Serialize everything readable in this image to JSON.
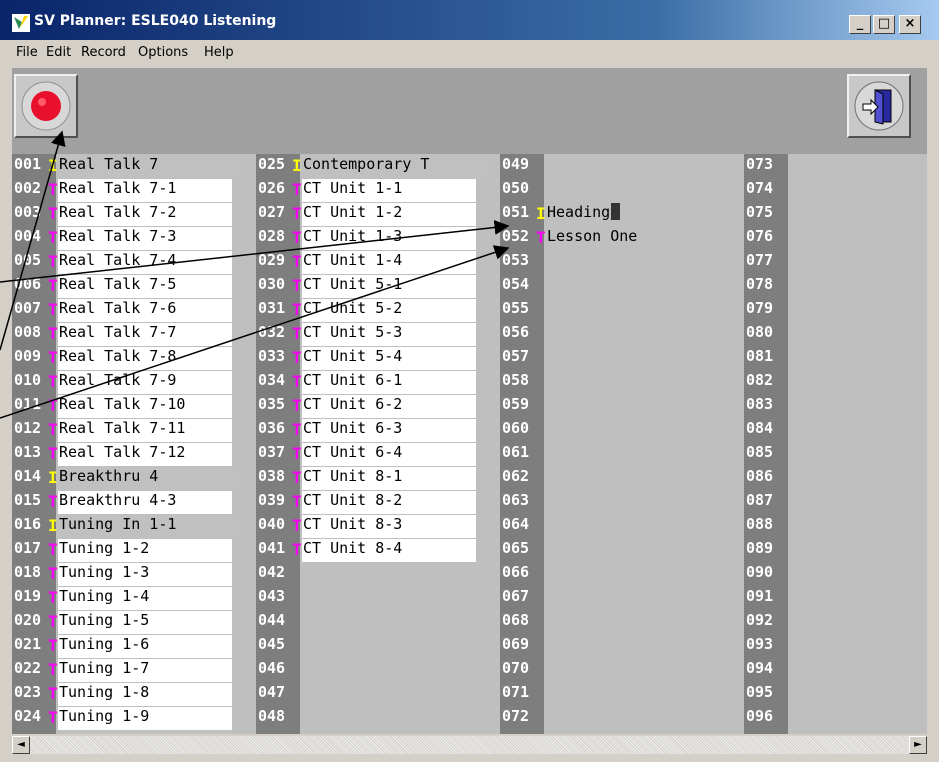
{
  "window": {
    "title": "SV Planner: ESLE040 Listening"
  },
  "caption_buttons": {
    "minimize": "_",
    "maximize": "□",
    "close": "×"
  },
  "menu": [
    "File",
    "Edit",
    "Record",
    "Options",
    "Help"
  ],
  "toolbar": {
    "record_icon": "record-icon",
    "exit_icon": "exit-door-icon"
  },
  "columns": [
    {
      "rows": [
        {
          "num": "001",
          "flag": "I",
          "text": "Real Talk 7",
          "bg": "grey"
        },
        {
          "num": "002",
          "flag": "T",
          "text": "Real Talk 7-1",
          "bg": "white"
        },
        {
          "num": "003",
          "flag": "T",
          "text": "Real Talk 7-2",
          "bg": "white"
        },
        {
          "num": "004",
          "flag": "T",
          "text": "Real Talk 7-3",
          "bg": "white"
        },
        {
          "num": "005",
          "flag": "T",
          "text": "Real Talk 7-4",
          "bg": "white"
        },
        {
          "num": "006",
          "flag": "T",
          "text": "Real Talk 7-5",
          "bg": "white"
        },
        {
          "num": "007",
          "flag": "T",
          "text": "Real Talk 7-6",
          "bg": "white"
        },
        {
          "num": "008",
          "flag": "T",
          "text": "Real Talk 7-7",
          "bg": "white"
        },
        {
          "num": "009",
          "flag": "T",
          "text": "Real Talk 7-8",
          "bg": "white"
        },
        {
          "num": "010",
          "flag": "T",
          "text": "Real Talk 7-9",
          "bg": "white"
        },
        {
          "num": "011",
          "flag": "T",
          "text": "Real Talk 7-10",
          "bg": "white"
        },
        {
          "num": "012",
          "flag": "T",
          "text": "Real Talk 7-11",
          "bg": "white"
        },
        {
          "num": "013",
          "flag": "T",
          "text": "Real Talk 7-12",
          "bg": "white"
        },
        {
          "num": "014",
          "flag": "I",
          "text": "Breakthru 4",
          "bg": "grey"
        },
        {
          "num": "015",
          "flag": "T",
          "text": "Breakthru 4-3",
          "bg": "white"
        },
        {
          "num": "016",
          "flag": "I",
          "text": "Tuning In 1-1",
          "bg": "grey"
        },
        {
          "num": "017",
          "flag": "T",
          "text": "Tuning 1-2",
          "bg": "white"
        },
        {
          "num": "018",
          "flag": "T",
          "text": "Tuning 1-3",
          "bg": "white"
        },
        {
          "num": "019",
          "flag": "T",
          "text": "Tuning 1-4",
          "bg": "white"
        },
        {
          "num": "020",
          "flag": "T",
          "text": "Tuning 1-5",
          "bg": "white"
        },
        {
          "num": "021",
          "flag": "T",
          "text": "Tuning 1-6",
          "bg": "white"
        },
        {
          "num": "022",
          "flag": "T",
          "text": "Tuning 1-7",
          "bg": "white"
        },
        {
          "num": "023",
          "flag": "T",
          "text": "Tuning 1-8",
          "bg": "white"
        },
        {
          "num": "024",
          "flag": "T",
          "text": "Tuning 1-9",
          "bg": "white"
        }
      ]
    },
    {
      "rows": [
        {
          "num": "025",
          "flag": "I",
          "text": "Contemporary T",
          "bg": "grey"
        },
        {
          "num": "026",
          "flag": "T",
          "text": "CT Unit 1-1",
          "bg": "white"
        },
        {
          "num": "027",
          "flag": "T",
          "text": "CT Unit 1-2",
          "bg": "white"
        },
        {
          "num": "028",
          "flag": "T",
          "text": "CT Unit 1-3",
          "bg": "white"
        },
        {
          "num": "029",
          "flag": "T",
          "text": "CT Unit 1-4",
          "bg": "white"
        },
        {
          "num": "030",
          "flag": "T",
          "text": "CT Unit 5-1",
          "bg": "white"
        },
        {
          "num": "031",
          "flag": "T",
          "text": "CT Unit 5-2",
          "bg": "white"
        },
        {
          "num": "032",
          "flag": "T",
          "text": "CT Unit 5-3",
          "bg": "white"
        },
        {
          "num": "033",
          "flag": "T",
          "text": "CT Unit 5-4",
          "bg": "white"
        },
        {
          "num": "034",
          "flag": "T",
          "text": "CT Unit 6-1",
          "bg": "white"
        },
        {
          "num": "035",
          "flag": "T",
          "text": "CT Unit 6-2",
          "bg": "white"
        },
        {
          "num": "036",
          "flag": "T",
          "text": "CT Unit 6-3",
          "bg": "white"
        },
        {
          "num": "037",
          "flag": "T",
          "text": "CT Unit 6-4",
          "bg": "white"
        },
        {
          "num": "038",
          "flag": "T",
          "text": "CT Unit 8-1",
          "bg": "white"
        },
        {
          "num": "039",
          "flag": "T",
          "text": "CT Unit 8-2",
          "bg": "white"
        },
        {
          "num": "040",
          "flag": "T",
          "text": "CT Unit 8-3",
          "bg": "white"
        },
        {
          "num": "041",
          "flag": "T",
          "text": "CT Unit 8-4",
          "bg": "white"
        },
        {
          "num": "042",
          "flag": "",
          "text": "",
          "bg": "plain"
        },
        {
          "num": "043",
          "flag": "",
          "text": "",
          "bg": "plain"
        },
        {
          "num": "044",
          "flag": "",
          "text": "",
          "bg": "plain"
        },
        {
          "num": "045",
          "flag": "",
          "text": "",
          "bg": "plain"
        },
        {
          "num": "046",
          "flag": "",
          "text": "",
          "bg": "plain"
        },
        {
          "num": "047",
          "flag": "",
          "text": "",
          "bg": "plain"
        },
        {
          "num": "048",
          "flag": "",
          "text": "",
          "bg": "plain"
        }
      ]
    },
    {
      "rows": [
        {
          "num": "049",
          "flag": "",
          "text": "",
          "bg": "plain"
        },
        {
          "num": "050",
          "flag": "",
          "text": "",
          "bg": "plain"
        },
        {
          "num": "051",
          "flag": "I",
          "text": "Heading",
          "bg": "plain",
          "cursor": true
        },
        {
          "num": "052",
          "flag": "T",
          "text": "Lesson One",
          "bg": "plain"
        },
        {
          "num": "053",
          "flag": "",
          "text": "",
          "bg": "plain"
        },
        {
          "num": "054",
          "flag": "",
          "text": "",
          "bg": "plain"
        },
        {
          "num": "055",
          "flag": "",
          "text": "",
          "bg": "plain"
        },
        {
          "num": "056",
          "flag": "",
          "text": "",
          "bg": "plain"
        },
        {
          "num": "057",
          "flag": "",
          "text": "",
          "bg": "plain"
        },
        {
          "num": "058",
          "flag": "",
          "text": "",
          "bg": "plain"
        },
        {
          "num": "059",
          "flag": "",
          "text": "",
          "bg": "plain"
        },
        {
          "num": "060",
          "flag": "",
          "text": "",
          "bg": "plain"
        },
        {
          "num": "061",
          "flag": "",
          "text": "",
          "bg": "plain"
        },
        {
          "num": "062",
          "flag": "",
          "text": "",
          "bg": "plain"
        },
        {
          "num": "063",
          "flag": "",
          "text": "",
          "bg": "plain"
        },
        {
          "num": "064",
          "flag": "",
          "text": "",
          "bg": "plain"
        },
        {
          "num": "065",
          "flag": "",
          "text": "",
          "bg": "plain"
        },
        {
          "num": "066",
          "flag": "",
          "text": "",
          "bg": "plain"
        },
        {
          "num": "067",
          "flag": "",
          "text": "",
          "bg": "plain"
        },
        {
          "num": "068",
          "flag": "",
          "text": "",
          "bg": "plain"
        },
        {
          "num": "069",
          "flag": "",
          "text": "",
          "bg": "plain"
        },
        {
          "num": "070",
          "flag": "",
          "text": "",
          "bg": "plain"
        },
        {
          "num": "071",
          "flag": "",
          "text": "",
          "bg": "plain"
        },
        {
          "num": "072",
          "flag": "",
          "text": "",
          "bg": "plain"
        }
      ]
    },
    {
      "rows": [
        {
          "num": "073",
          "flag": "",
          "text": "",
          "bg": "plain"
        },
        {
          "num": "074",
          "flag": "",
          "text": "",
          "bg": "plain"
        },
        {
          "num": "075",
          "flag": "",
          "text": "",
          "bg": "plain"
        },
        {
          "num": "076",
          "flag": "",
          "text": "",
          "bg": "plain"
        },
        {
          "num": "077",
          "flag": "",
          "text": "",
          "bg": "plain"
        },
        {
          "num": "078",
          "flag": "",
          "text": "",
          "bg": "plain"
        },
        {
          "num": "079",
          "flag": "",
          "text": "",
          "bg": "plain"
        },
        {
          "num": "080",
          "flag": "",
          "text": "",
          "bg": "plain"
        },
        {
          "num": "081",
          "flag": "",
          "text": "",
          "bg": "plain"
        },
        {
          "num": "082",
          "flag": "",
          "text": "",
          "bg": "plain"
        },
        {
          "num": "083",
          "flag": "",
          "text": "",
          "bg": "plain"
        },
        {
          "num": "084",
          "flag": "",
          "text": "",
          "bg": "plain"
        },
        {
          "num": "085",
          "flag": "",
          "text": "",
          "bg": "plain"
        },
        {
          "num": "086",
          "flag": "",
          "text": "",
          "bg": "plain"
        },
        {
          "num": "087",
          "flag": "",
          "text": "",
          "bg": "plain"
        },
        {
          "num": "088",
          "flag": "",
          "text": "",
          "bg": "plain"
        },
        {
          "num": "089",
          "flag": "",
          "text": "",
          "bg": "plain"
        },
        {
          "num": "090",
          "flag": "",
          "text": "",
          "bg": "plain"
        },
        {
          "num": "091",
          "flag": "",
          "text": "",
          "bg": "plain"
        },
        {
          "num": "092",
          "flag": "",
          "text": "",
          "bg": "plain"
        },
        {
          "num": "093",
          "flag": "",
          "text": "",
          "bg": "plain"
        },
        {
          "num": "094",
          "flag": "",
          "text": "",
          "bg": "plain"
        },
        {
          "num": "095",
          "flag": "",
          "text": "",
          "bg": "plain"
        },
        {
          "num": "096",
          "flag": "",
          "text": "",
          "bg": "plain"
        }
      ]
    }
  ],
  "scrollbar": {
    "left_arrow": "◄",
    "right_arrow": "►"
  }
}
